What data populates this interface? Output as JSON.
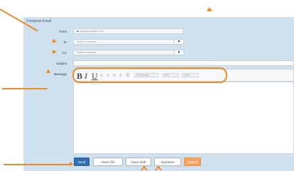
{
  "compose": {
    "title": "Compose Email",
    "fields": {
      "from": {
        "label": "From",
        "value": "you@example.com"
      },
      "to": {
        "label": "To",
        "value": "Select contacts"
      },
      "cc": {
        "label": "CC",
        "value": "Select contacts"
      },
      "subject": {
        "label": "Subject",
        "value": ""
      },
      "message": {
        "label": "Message"
      }
    },
    "select_button_glyph": "▼",
    "toolbar": {
      "bold": "B",
      "italic": "I",
      "underline": "U",
      "align_left": "≡",
      "align_center": "≡",
      "align_right": "≡",
      "align_justify": "≡",
      "list": "☰",
      "font_family": "Font family",
      "font_size": "Size",
      "font_color": "Color"
    },
    "buttons": {
      "send": "Send",
      "attach_file": "Attach file",
      "save_draft": "Save draft",
      "add_signature": "Signature",
      "cancel": "Cancel"
    }
  },
  "annotation_color": "#f08a24"
}
